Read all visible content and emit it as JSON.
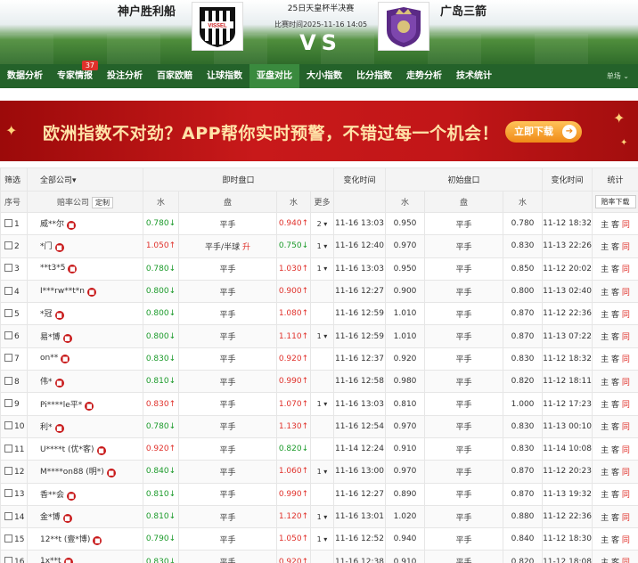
{
  "match": {
    "home_team": "神户胜利船",
    "away_team": "广岛三箭",
    "event": "25日天皇杯半决赛",
    "match_time": "比赛时间2025-11-16 14:05",
    "vs": "VS",
    "home_logo_text": "VISSEL"
  },
  "nav": {
    "items": [
      {
        "label": "数据分析"
      },
      {
        "label": "专家情报",
        "badge": "37"
      },
      {
        "label": "投注分析"
      },
      {
        "label": "百家欧赔"
      },
      {
        "label": "让球指数"
      },
      {
        "label": "亚盘对比",
        "active": true
      },
      {
        "label": "大小指数"
      },
      {
        "label": "比分指数"
      },
      {
        "label": "走势分析"
      },
      {
        "label": "技术统计"
      }
    ],
    "more_label": "单场"
  },
  "banner": {
    "text": "欧洲指数不对劲？APP帮你实时预警，不错过每一个机会！",
    "button": "立即下载"
  },
  "table": {
    "header1": {
      "filter": "筛选",
      "all_companies": "全部公司",
      "live": "即时盘口",
      "change_time": "变化时间",
      "initial": "初始盘口",
      "change_time2": "变化时间",
      "stats": "统计"
    },
    "header2": {
      "seq": "序号",
      "company": "赔率公司",
      "custom": "定制",
      "water1": "水",
      "handicap": "盘",
      "water2": "水",
      "more": "更多",
      "iwater1": "水",
      "ihandicap": "盘",
      "iwater2": "水",
      "download": "赔率下载"
    },
    "rows": [
      {
        "no": "1",
        "company": "威**尔",
        "w1": "0.780↓",
        "w1c": "green",
        "hc": "平手",
        "hcx": "",
        "w2": "0.940↑",
        "w2c": "red",
        "more": "2 ▾",
        "time": "11-16 13:03",
        "iw1": "0.950",
        "ih": "平手",
        "iw2": "0.780",
        "itime": "11-12 18:32"
      },
      {
        "no": "2",
        "company": "*门",
        "w1": "1.050↑",
        "w1c": "red",
        "hc": "平手/半球",
        "hcx": "升",
        "w2": "0.750↓",
        "w2c": "green",
        "more": "1 ▾",
        "time": "11-16 12:40",
        "iw1": "0.970",
        "ih": "平手",
        "iw2": "0.830",
        "itime": "11-13 22:26"
      },
      {
        "no": "3",
        "company": "**t3*5",
        "w1": "0.780↓",
        "w1c": "green",
        "hc": "平手",
        "hcx": "",
        "w2": "1.030↑",
        "w2c": "red",
        "more": "1 ▾",
        "time": "11-16 13:03",
        "iw1": "0.950",
        "ih": "平手",
        "iw2": "0.850",
        "itime": "11-12 20:02"
      },
      {
        "no": "4",
        "company": "I***rw**t*n",
        "w1": "0.800↓",
        "w1c": "green",
        "hc": "平手",
        "hcx": "",
        "w2": "0.900↑",
        "w2c": "red",
        "more": "",
        "time": "11-16 12:27",
        "iw1": "0.900",
        "ih": "平手",
        "iw2": "0.800",
        "itime": "11-13 02:40"
      },
      {
        "no": "5",
        "company": "*冠",
        "w1": "0.800↓",
        "w1c": "green",
        "hc": "平手",
        "hcx": "",
        "w2": "1.080↑",
        "w2c": "red",
        "more": "",
        "time": "11-16 12:59",
        "iw1": "1.010",
        "ih": "平手",
        "iw2": "0.870",
        "itime": "11-12 22:36"
      },
      {
        "no": "6",
        "company": "易*博",
        "w1": "0.800↓",
        "w1c": "green",
        "hc": "平手",
        "hcx": "",
        "w2": "1.110↑",
        "w2c": "red",
        "more": "1 ▾",
        "time": "11-16 12:59",
        "iw1": "1.010",
        "ih": "平手",
        "iw2": "0.870",
        "itime": "11-13 07:22"
      },
      {
        "no": "7",
        "company": "on**",
        "w1": "0.830↓",
        "w1c": "green",
        "hc": "平手",
        "hcx": "",
        "w2": "0.920↑",
        "w2c": "red",
        "more": "",
        "time": "11-16 12:37",
        "iw1": "0.920",
        "ih": "平手",
        "iw2": "0.830",
        "itime": "11-12 18:32"
      },
      {
        "no": "8",
        "company": "伟*",
        "w1": "0.810↓",
        "w1c": "green",
        "hc": "平手",
        "hcx": "",
        "w2": "0.990↑",
        "w2c": "red",
        "more": "",
        "time": "11-16 12:58",
        "iw1": "0.980",
        "ih": "平手",
        "iw2": "0.820",
        "itime": "11-12 18:11"
      },
      {
        "no": "9",
        "company": "Pi****le平*",
        "w1": "0.830↑",
        "w1c": "red",
        "hc": "平手",
        "hcx": "",
        "w2": "1.070↑",
        "w2c": "red",
        "more": "1 ▾",
        "time": "11-16 13:03",
        "iw1": "0.810",
        "ih": "平手",
        "iw2": "1.000",
        "itime": "11-12 17:23"
      },
      {
        "no": "10",
        "company": "利*",
        "w1": "0.780↓",
        "w1c": "green",
        "hc": "平手",
        "hcx": "",
        "w2": "1.130↑",
        "w2c": "red",
        "more": "",
        "time": "11-16 12:54",
        "iw1": "0.970",
        "ih": "平手",
        "iw2": "0.830",
        "itime": "11-13 00:10"
      },
      {
        "no": "11",
        "company": "U****t (优*客)",
        "w1": "0.920↑",
        "w1c": "red",
        "hc": "平手",
        "hcx": "",
        "w2": "0.820↓",
        "w2c": "green",
        "more": "",
        "time": "11-14 12:24",
        "iw1": "0.910",
        "ih": "平手",
        "iw2": "0.830",
        "itime": "11-14 10:08"
      },
      {
        "no": "12",
        "company": "M****on88 (明*)",
        "w1": "0.840↓",
        "w1c": "green",
        "hc": "平手",
        "hcx": "",
        "w2": "1.060↑",
        "w2c": "red",
        "more": "1 ▾",
        "time": "11-16 13:00",
        "iw1": "0.970",
        "ih": "平手",
        "iw2": "0.870",
        "itime": "11-12 20:23"
      },
      {
        "no": "13",
        "company": "香**会",
        "w1": "0.810↓",
        "w1c": "green",
        "hc": "平手",
        "hcx": "",
        "w2": "0.990↑",
        "w2c": "red",
        "more": "",
        "time": "11-16 12:27",
        "iw1": "0.890",
        "ih": "平手",
        "iw2": "0.870",
        "itime": "11-13 19:32"
      },
      {
        "no": "14",
        "company": "金*博",
        "w1": "0.810↓",
        "w1c": "green",
        "hc": "平手",
        "hcx": "",
        "w2": "1.120↑",
        "w2c": "red",
        "more": "1 ▾",
        "time": "11-16 13:01",
        "iw1": "1.020",
        "ih": "平手",
        "iw2": "0.880",
        "itime": "11-12 22:36"
      },
      {
        "no": "15",
        "company": "12**t (壹*博)",
        "w1": "0.790↓",
        "w1c": "green",
        "hc": "平手",
        "hcx": "",
        "w2": "1.050↑",
        "w2c": "red",
        "more": "1 ▾",
        "time": "11-16 12:52",
        "iw1": "0.940",
        "ih": "平手",
        "iw2": "0.840",
        "itime": "11-12 18:30"
      },
      {
        "no": "16",
        "company": "1x**t",
        "w1": "0.830↓",
        "w1c": "green",
        "hc": "平手",
        "hcx": "",
        "w2": "0.920↑",
        "w2c": "red",
        "more": "",
        "time": "11-16 12:38",
        "iw1": "0.910",
        "ih": "平手",
        "iw2": "0.820",
        "itime": "11-12 18:08"
      }
    ],
    "row_links": {
      "home": "主",
      "away": "客",
      "same": "同"
    }
  },
  "colors": {
    "nav_bg": "#24622a",
    "up": "#e0312b",
    "down": "#1b9a2a",
    "banner_bg": "#c8191a"
  }
}
